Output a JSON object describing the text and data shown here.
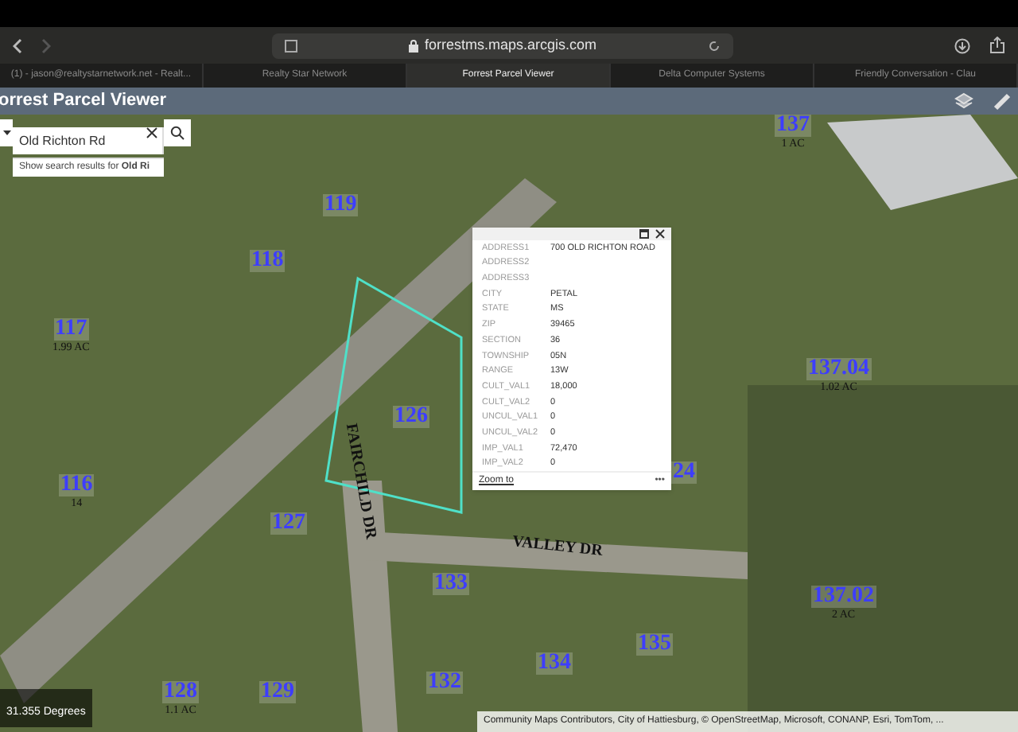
{
  "browser": {
    "url": "forrestms.maps.arcgis.com",
    "tabs": [
      {
        "label": "(1) - jason@realtystarnetwork.net - Realt...",
        "selected": false
      },
      {
        "label": "Realty Star Network",
        "selected": false
      },
      {
        "label": "Forrest Parcel Viewer",
        "selected": true
      },
      {
        "label": "Delta Computer Systems",
        "selected": false
      },
      {
        "label": "Friendly Conversation - Clau",
        "selected": false
      }
    ]
  },
  "app": {
    "title": "orrest Parcel Viewer"
  },
  "search": {
    "value": "Old Richton Rd",
    "suggestion": "Show search results for **Old Ri**"
  },
  "map": {
    "parcels": [
      {
        "label": "137",
        "sub": "1 AC"
      },
      {
        "label": "119"
      },
      {
        "label": "118"
      },
      {
        "label": "117",
        "sub": "1.99 AC"
      },
      {
        "label": "137.04",
        "sub": "1.02 AC"
      },
      {
        "label": "126"
      },
      {
        "label": "24"
      },
      {
        "label": "116",
        "sub": "14"
      },
      {
        "label": "127"
      },
      {
        "label": "133"
      },
      {
        "label": "137.02",
        "sub": "2 AC"
      },
      {
        "label": "135"
      },
      {
        "label": "134"
      },
      {
        "label": "128",
        "sub": "1.1 AC"
      },
      {
        "label": "129"
      },
      {
        "label": "132"
      }
    ],
    "streets": [
      {
        "label": "VALLEY DR"
      },
      {
        "label": "FAIRCHILD DR"
      }
    ],
    "coordinates": "31.355 Degrees",
    "attribution": "Community Maps Contributors, City of Hattiesburg, © OpenStreetMap, Microsoft, CONANP, Esri, TomTom, ..."
  },
  "popup": {
    "rows": [
      {
        "label": "ADDRESS1",
        "value": "700 OLD RICHTON ROAD"
      },
      {
        "label": "ADDRESS2",
        "value": ""
      },
      {
        "label": "ADDRESS3",
        "value": ""
      },
      {
        "label": "CITY",
        "value": "PETAL"
      },
      {
        "label": "STATE",
        "value": "MS"
      },
      {
        "label": "ZIP",
        "value": "39465"
      },
      {
        "label": "SECTION",
        "value": "36"
      },
      {
        "label": "TOWNSHIP",
        "value": "05N"
      },
      {
        "label": "RANGE",
        "value": "13W"
      },
      {
        "label": "CULT_VAL1",
        "value": "18,000"
      },
      {
        "label": "CULT_VAL2",
        "value": "0"
      },
      {
        "label": "UNCUL_VAL1",
        "value": "0"
      },
      {
        "label": "UNCUL_VAL2",
        "value": "0"
      },
      {
        "label": "IMP_VAL1",
        "value": "72,470"
      },
      {
        "label": "IMP_VAL2",
        "value": "0"
      }
    ],
    "link": "Zoom to",
    "more": "•••"
  }
}
